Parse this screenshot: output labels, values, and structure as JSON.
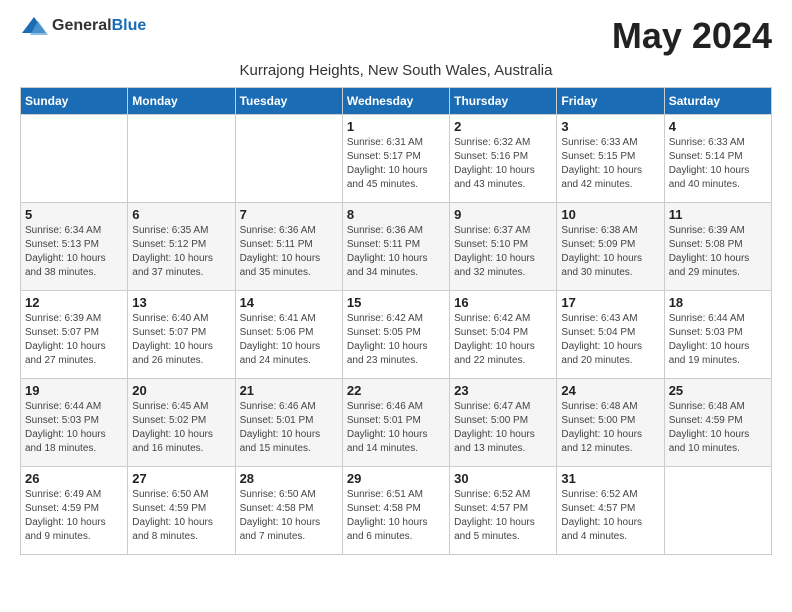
{
  "logo": {
    "general": "General",
    "blue": "Blue"
  },
  "title": "May 2024",
  "location": "Kurrajong Heights, New South Wales, Australia",
  "days_of_week": [
    "Sunday",
    "Monday",
    "Tuesday",
    "Wednesday",
    "Thursday",
    "Friday",
    "Saturday"
  ],
  "weeks": [
    [
      {
        "day": "",
        "info": ""
      },
      {
        "day": "",
        "info": ""
      },
      {
        "day": "",
        "info": ""
      },
      {
        "day": "1",
        "info": "Sunrise: 6:31 AM\nSunset: 5:17 PM\nDaylight: 10 hours\nand 45 minutes."
      },
      {
        "day": "2",
        "info": "Sunrise: 6:32 AM\nSunset: 5:16 PM\nDaylight: 10 hours\nand 43 minutes."
      },
      {
        "day": "3",
        "info": "Sunrise: 6:33 AM\nSunset: 5:15 PM\nDaylight: 10 hours\nand 42 minutes."
      },
      {
        "day": "4",
        "info": "Sunrise: 6:33 AM\nSunset: 5:14 PM\nDaylight: 10 hours\nand 40 minutes."
      }
    ],
    [
      {
        "day": "5",
        "info": "Sunrise: 6:34 AM\nSunset: 5:13 PM\nDaylight: 10 hours\nand 38 minutes."
      },
      {
        "day": "6",
        "info": "Sunrise: 6:35 AM\nSunset: 5:12 PM\nDaylight: 10 hours\nand 37 minutes."
      },
      {
        "day": "7",
        "info": "Sunrise: 6:36 AM\nSunset: 5:11 PM\nDaylight: 10 hours\nand 35 minutes."
      },
      {
        "day": "8",
        "info": "Sunrise: 6:36 AM\nSunset: 5:11 PM\nDaylight: 10 hours\nand 34 minutes."
      },
      {
        "day": "9",
        "info": "Sunrise: 6:37 AM\nSunset: 5:10 PM\nDaylight: 10 hours\nand 32 minutes."
      },
      {
        "day": "10",
        "info": "Sunrise: 6:38 AM\nSunset: 5:09 PM\nDaylight: 10 hours\nand 30 minutes."
      },
      {
        "day": "11",
        "info": "Sunrise: 6:39 AM\nSunset: 5:08 PM\nDaylight: 10 hours\nand 29 minutes."
      }
    ],
    [
      {
        "day": "12",
        "info": "Sunrise: 6:39 AM\nSunset: 5:07 PM\nDaylight: 10 hours\nand 27 minutes."
      },
      {
        "day": "13",
        "info": "Sunrise: 6:40 AM\nSunset: 5:07 PM\nDaylight: 10 hours\nand 26 minutes."
      },
      {
        "day": "14",
        "info": "Sunrise: 6:41 AM\nSunset: 5:06 PM\nDaylight: 10 hours\nand 24 minutes."
      },
      {
        "day": "15",
        "info": "Sunrise: 6:42 AM\nSunset: 5:05 PM\nDaylight: 10 hours\nand 23 minutes."
      },
      {
        "day": "16",
        "info": "Sunrise: 6:42 AM\nSunset: 5:04 PM\nDaylight: 10 hours\nand 22 minutes."
      },
      {
        "day": "17",
        "info": "Sunrise: 6:43 AM\nSunset: 5:04 PM\nDaylight: 10 hours\nand 20 minutes."
      },
      {
        "day": "18",
        "info": "Sunrise: 6:44 AM\nSunset: 5:03 PM\nDaylight: 10 hours\nand 19 minutes."
      }
    ],
    [
      {
        "day": "19",
        "info": "Sunrise: 6:44 AM\nSunset: 5:03 PM\nDaylight: 10 hours\nand 18 minutes."
      },
      {
        "day": "20",
        "info": "Sunrise: 6:45 AM\nSunset: 5:02 PM\nDaylight: 10 hours\nand 16 minutes."
      },
      {
        "day": "21",
        "info": "Sunrise: 6:46 AM\nSunset: 5:01 PM\nDaylight: 10 hours\nand 15 minutes."
      },
      {
        "day": "22",
        "info": "Sunrise: 6:46 AM\nSunset: 5:01 PM\nDaylight: 10 hours\nand 14 minutes."
      },
      {
        "day": "23",
        "info": "Sunrise: 6:47 AM\nSunset: 5:00 PM\nDaylight: 10 hours\nand 13 minutes."
      },
      {
        "day": "24",
        "info": "Sunrise: 6:48 AM\nSunset: 5:00 PM\nDaylight: 10 hours\nand 12 minutes."
      },
      {
        "day": "25",
        "info": "Sunrise: 6:48 AM\nSunset: 4:59 PM\nDaylight: 10 hours\nand 10 minutes."
      }
    ],
    [
      {
        "day": "26",
        "info": "Sunrise: 6:49 AM\nSunset: 4:59 PM\nDaylight: 10 hours\nand 9 minutes."
      },
      {
        "day": "27",
        "info": "Sunrise: 6:50 AM\nSunset: 4:59 PM\nDaylight: 10 hours\nand 8 minutes."
      },
      {
        "day": "28",
        "info": "Sunrise: 6:50 AM\nSunset: 4:58 PM\nDaylight: 10 hours\nand 7 minutes."
      },
      {
        "day": "29",
        "info": "Sunrise: 6:51 AM\nSunset: 4:58 PM\nDaylight: 10 hours\nand 6 minutes."
      },
      {
        "day": "30",
        "info": "Sunrise: 6:52 AM\nSunset: 4:57 PM\nDaylight: 10 hours\nand 5 minutes."
      },
      {
        "day": "31",
        "info": "Sunrise: 6:52 AM\nSunset: 4:57 PM\nDaylight: 10 hours\nand 4 minutes."
      },
      {
        "day": "",
        "info": ""
      }
    ]
  ]
}
